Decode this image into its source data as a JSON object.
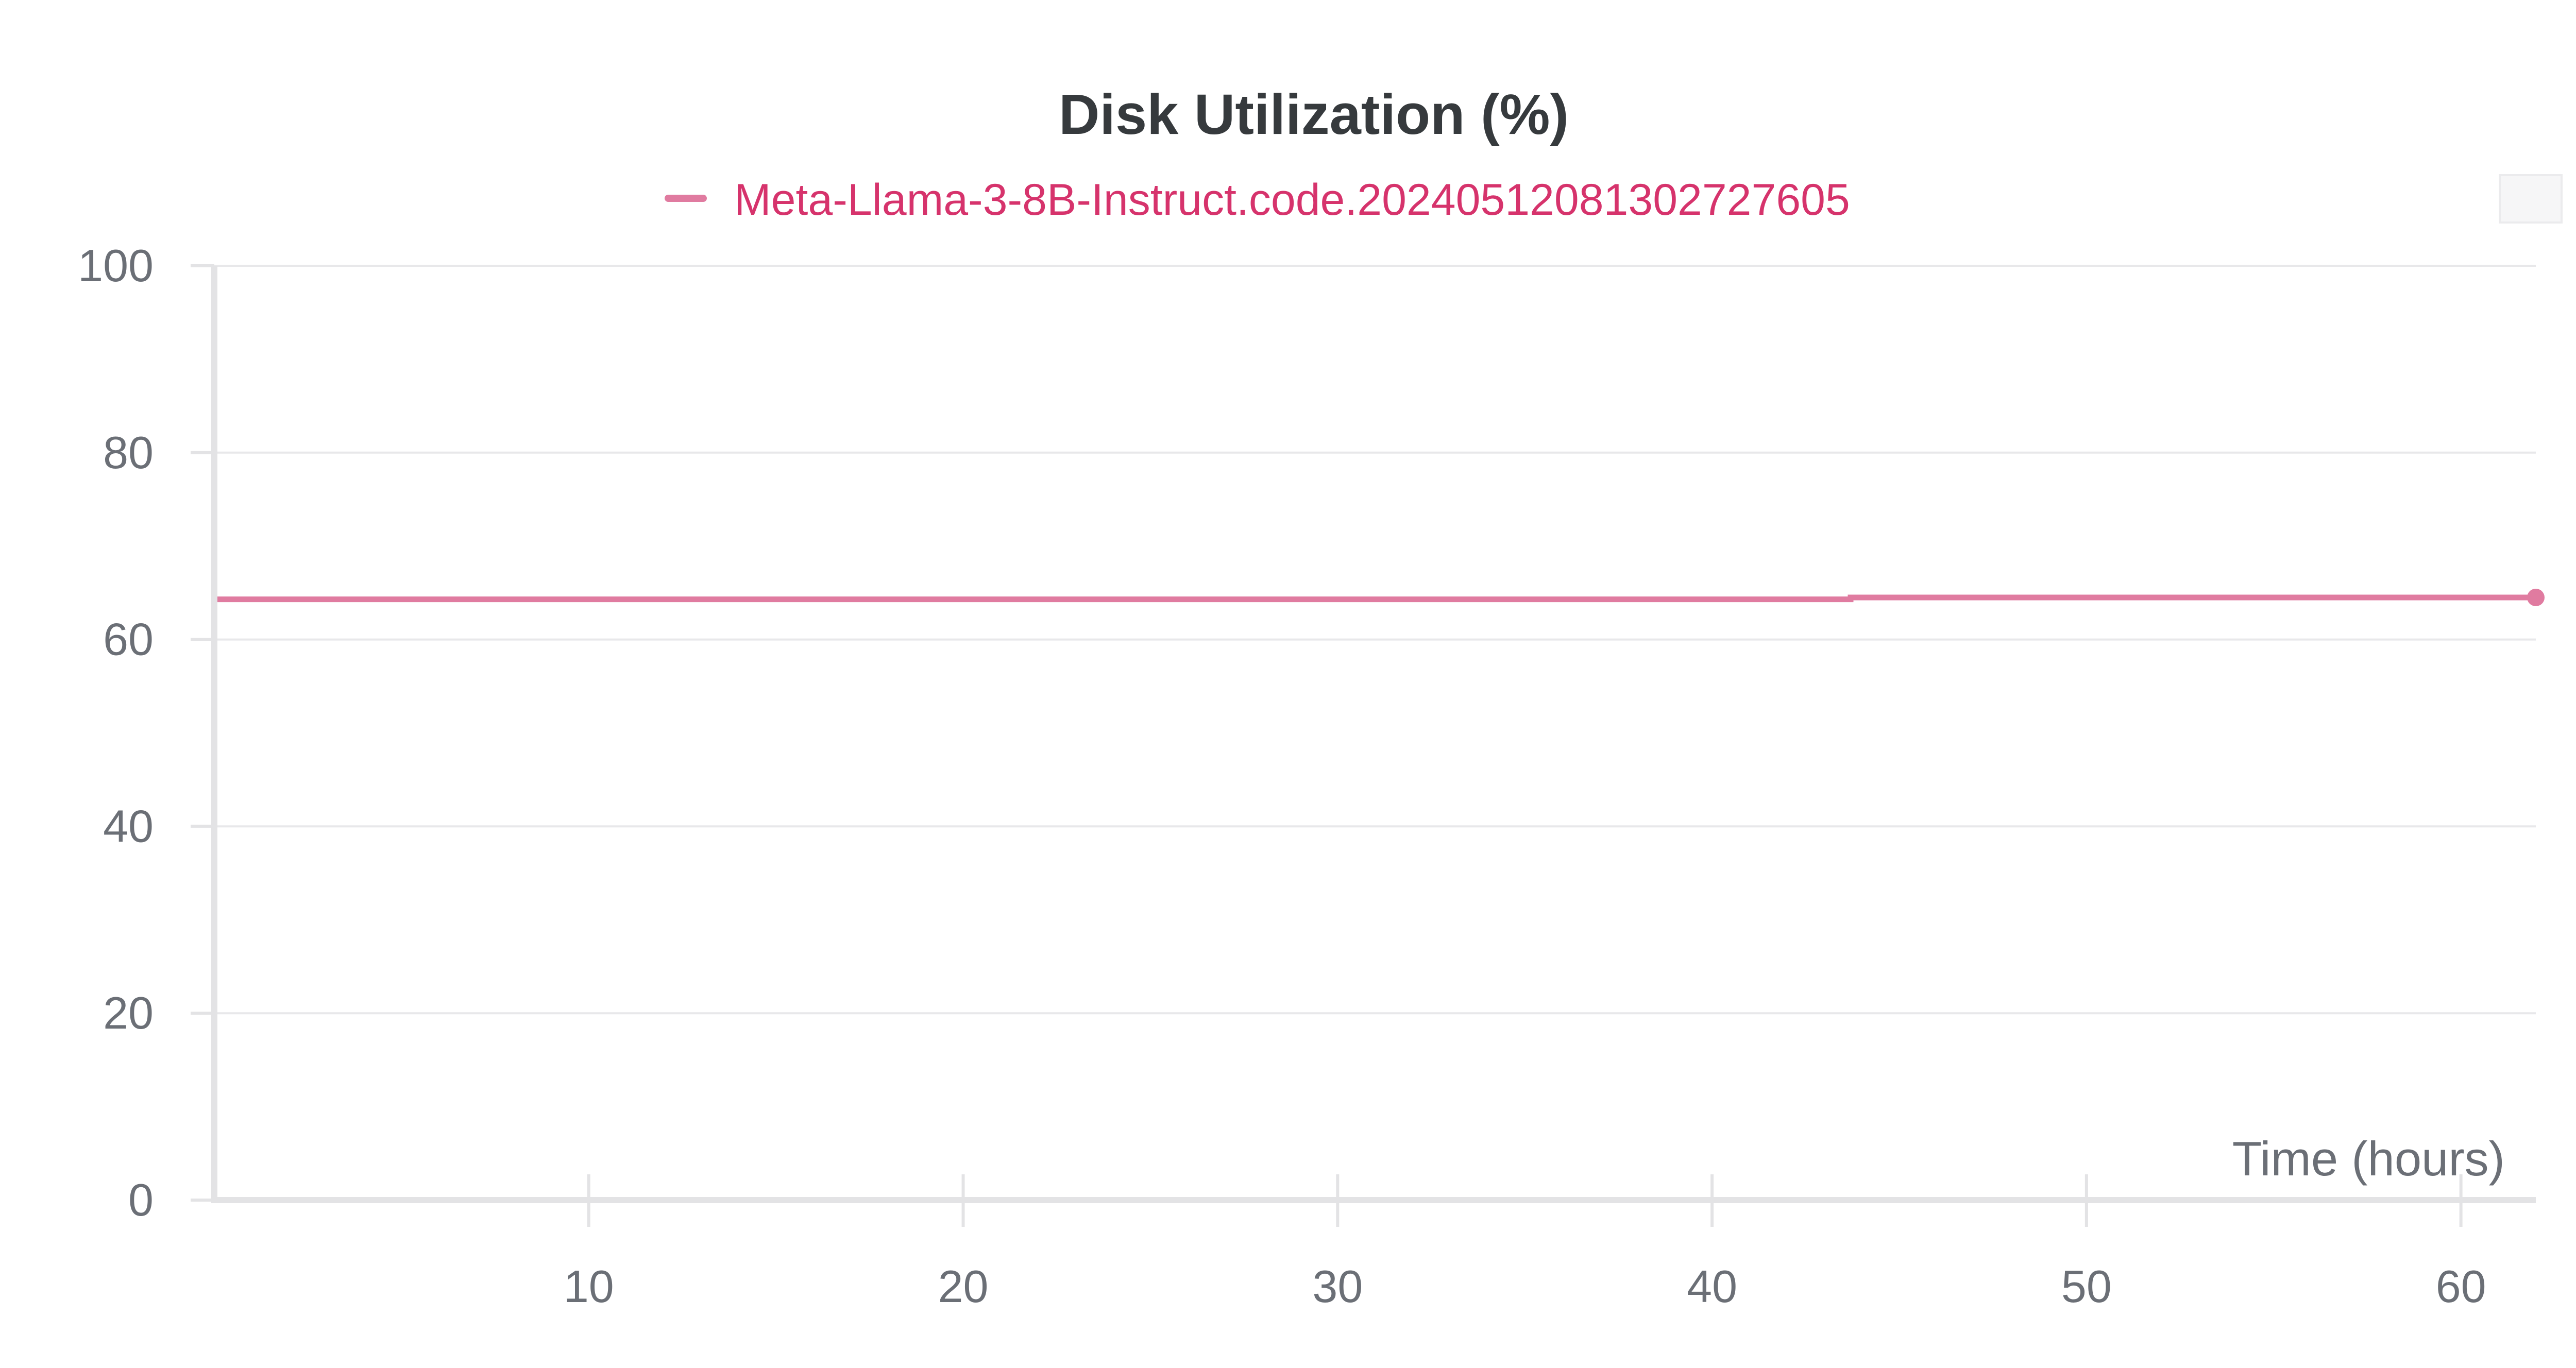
{
  "chart_data": {
    "type": "line",
    "title": "Disk Utilization (%)",
    "xlabel": "Time (hours)",
    "ylabel": "",
    "xlim": [
      0,
      62
    ],
    "ylim": [
      0,
      100
    ],
    "x_ticks": [
      10,
      20,
      30,
      40,
      50,
      60
    ],
    "x_tick_labels": [
      "10",
      "20",
      "30",
      "40",
      "50",
      "60"
    ],
    "y_ticks": [
      0,
      20,
      40,
      60,
      80,
      100
    ],
    "y_tick_labels": [
      "0",
      "20",
      "40",
      "60",
      "80",
      "100"
    ],
    "grid": true,
    "legend_position": "top-center",
    "series": [
      {
        "name": "Meta-Llama-3-8B-Instruct.code.20240512081302727605",
        "color": "#e07ba0",
        "x": [
          0,
          43.7,
          43.7,
          62
        ],
        "y": [
          64.3,
          64.3,
          64.5,
          64.5
        ]
      }
    ]
  }
}
